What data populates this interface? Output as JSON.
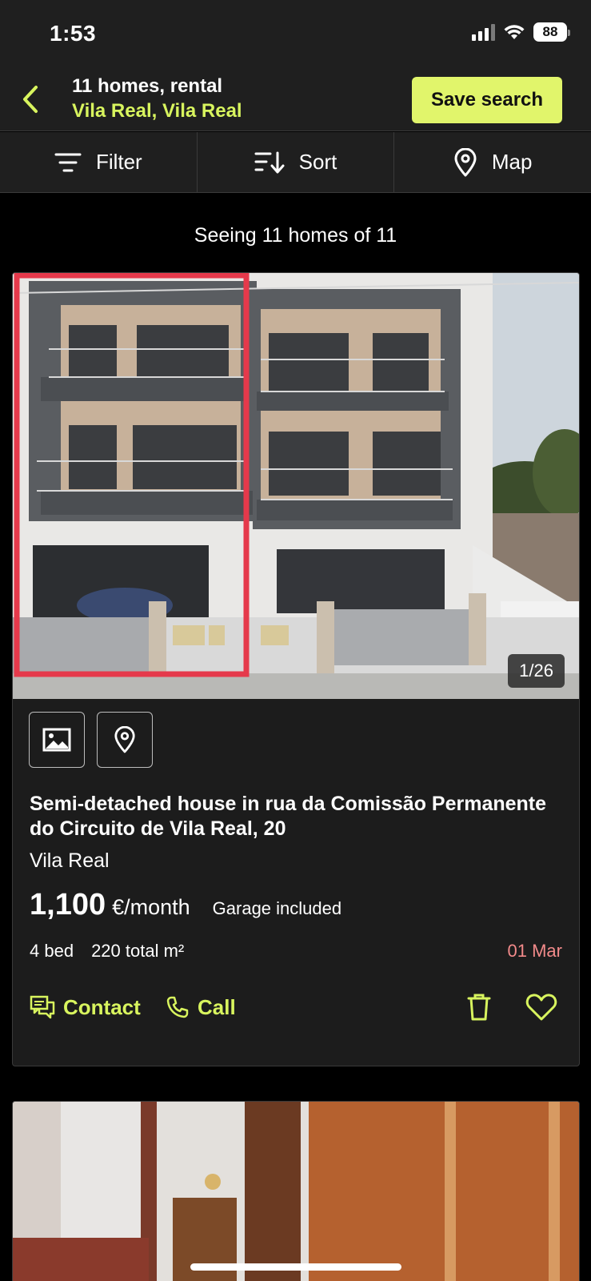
{
  "status_bar": {
    "time": "1:53",
    "battery": "88"
  },
  "header": {
    "back_icon": "chevron-left-icon",
    "title": "11 homes, rental",
    "subtitle": "Vila Real, Vila Real",
    "save_search": "Save search",
    "accent_color": "#e1f56b"
  },
  "toolbar": {
    "filter_label": "Filter",
    "sort_label": "Sort",
    "map_label": "Map"
  },
  "results": {
    "summary": "Seeing 11 homes of 11"
  },
  "listing": {
    "photo_counter": "1/26",
    "title": "Semi-detached house in rua da Comissão Permanente do Circuito de Vila Real, 20",
    "location": "Vila Real",
    "price": "1,100",
    "price_unit": "€/month",
    "extra": "Garage included",
    "bedrooms": "4 bed",
    "area": "220 total m²",
    "date": "01 Mar",
    "date_color": "#f28a8a",
    "contact_label": "Contact",
    "call_label": "Call"
  }
}
